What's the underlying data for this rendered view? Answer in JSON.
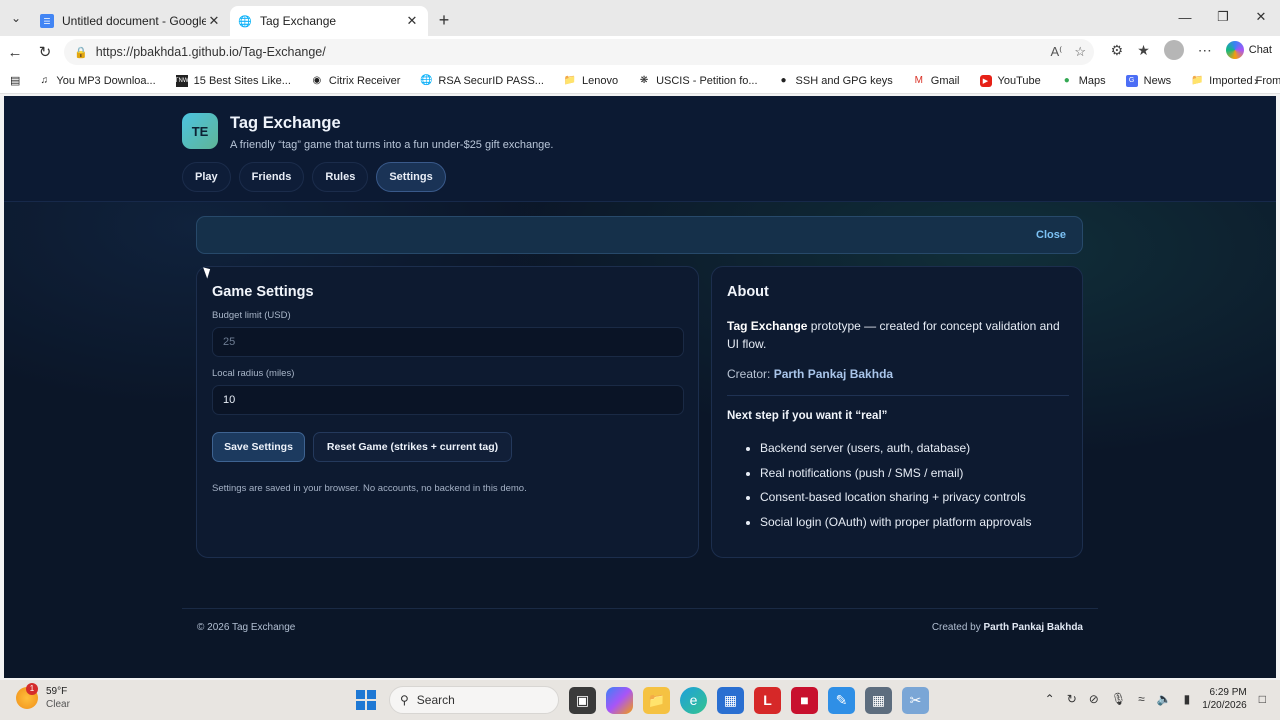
{
  "browser": {
    "tabs": [
      {
        "title": "Untitled document - Google Docs",
        "active": false,
        "icon": "google-docs-icon"
      },
      {
        "title": "Tag Exchange",
        "active": true,
        "icon": "globe-icon"
      }
    ],
    "url": "https://pbakhda1.github.io/Tag-Exchange/",
    "chat_label": "Chat",
    "bookmarks": [
      {
        "label": "You MP3 Downloa...",
        "icon": "mp3-icon"
      },
      {
        "label": "15 Best Sites Like...",
        "icon": "tnw-icon"
      },
      {
        "label": "Citrix Receiver",
        "icon": "citrix-icon"
      },
      {
        "label": "RSA SecurID PASS...",
        "icon": "globe-icon"
      },
      {
        "label": "Lenovo",
        "icon": "folder-icon"
      },
      {
        "label": "USCIS - Petition fo...",
        "icon": "uscis-icon"
      },
      {
        "label": "SSH and GPG keys",
        "icon": "github-icon"
      },
      {
        "label": "Gmail",
        "icon": "gmail-icon"
      },
      {
        "label": "YouTube",
        "icon": "youtube-icon"
      },
      {
        "label": "Maps",
        "icon": "maps-icon"
      },
      {
        "label": "News",
        "icon": "news-icon"
      },
      {
        "label": "Imported From IE",
        "icon": "folder-icon"
      }
    ]
  },
  "app": {
    "logo_text": "TE",
    "title": "Tag Exchange",
    "tagline": "A friendly “tag” game that turns into a fun under-$25 gift exchange.",
    "nav": [
      {
        "label": "Play",
        "active": false
      },
      {
        "label": "Friends",
        "active": false
      },
      {
        "label": "Rules",
        "active": false
      },
      {
        "label": "Settings",
        "active": true
      }
    ],
    "banner_close": "Close"
  },
  "settings": {
    "heading": "Game Settings",
    "budget_label": "Budget limit (USD)",
    "budget_placeholder": "25",
    "budget_value": "",
    "radius_label": "Local radius (miles)",
    "radius_value": "10",
    "save_button": "Save Settings",
    "reset_button": "Reset Game (strikes + current tag)",
    "note": "Settings are saved in your browser. No accounts, no backend in this demo."
  },
  "about": {
    "heading": "About",
    "desc_bold": "Tag Exchange",
    "desc_rest": " prototype — created for concept validation and UI flow.",
    "creator_label": "Creator: ",
    "creator_name": "Parth Pankaj Bakhda",
    "next_title": "Next step if you want it “real”",
    "next_items": [
      "Backend server (users, auth, database)",
      "Real notifications (push / SMS / email)",
      "Consent-based location sharing + privacy controls",
      "Social login (OAuth) with proper platform approvals"
    ]
  },
  "footer": {
    "copyright": "© 2026 Tag Exchange",
    "created_by_label": "Created by ",
    "created_by_name": "Parth Pankaj Bakhda"
  },
  "taskbar": {
    "temperature": "59°F",
    "condition": "Clear",
    "weather_alert": "1",
    "search_label": "Search",
    "time": "6:29 PM",
    "date": "1/20/2026"
  }
}
